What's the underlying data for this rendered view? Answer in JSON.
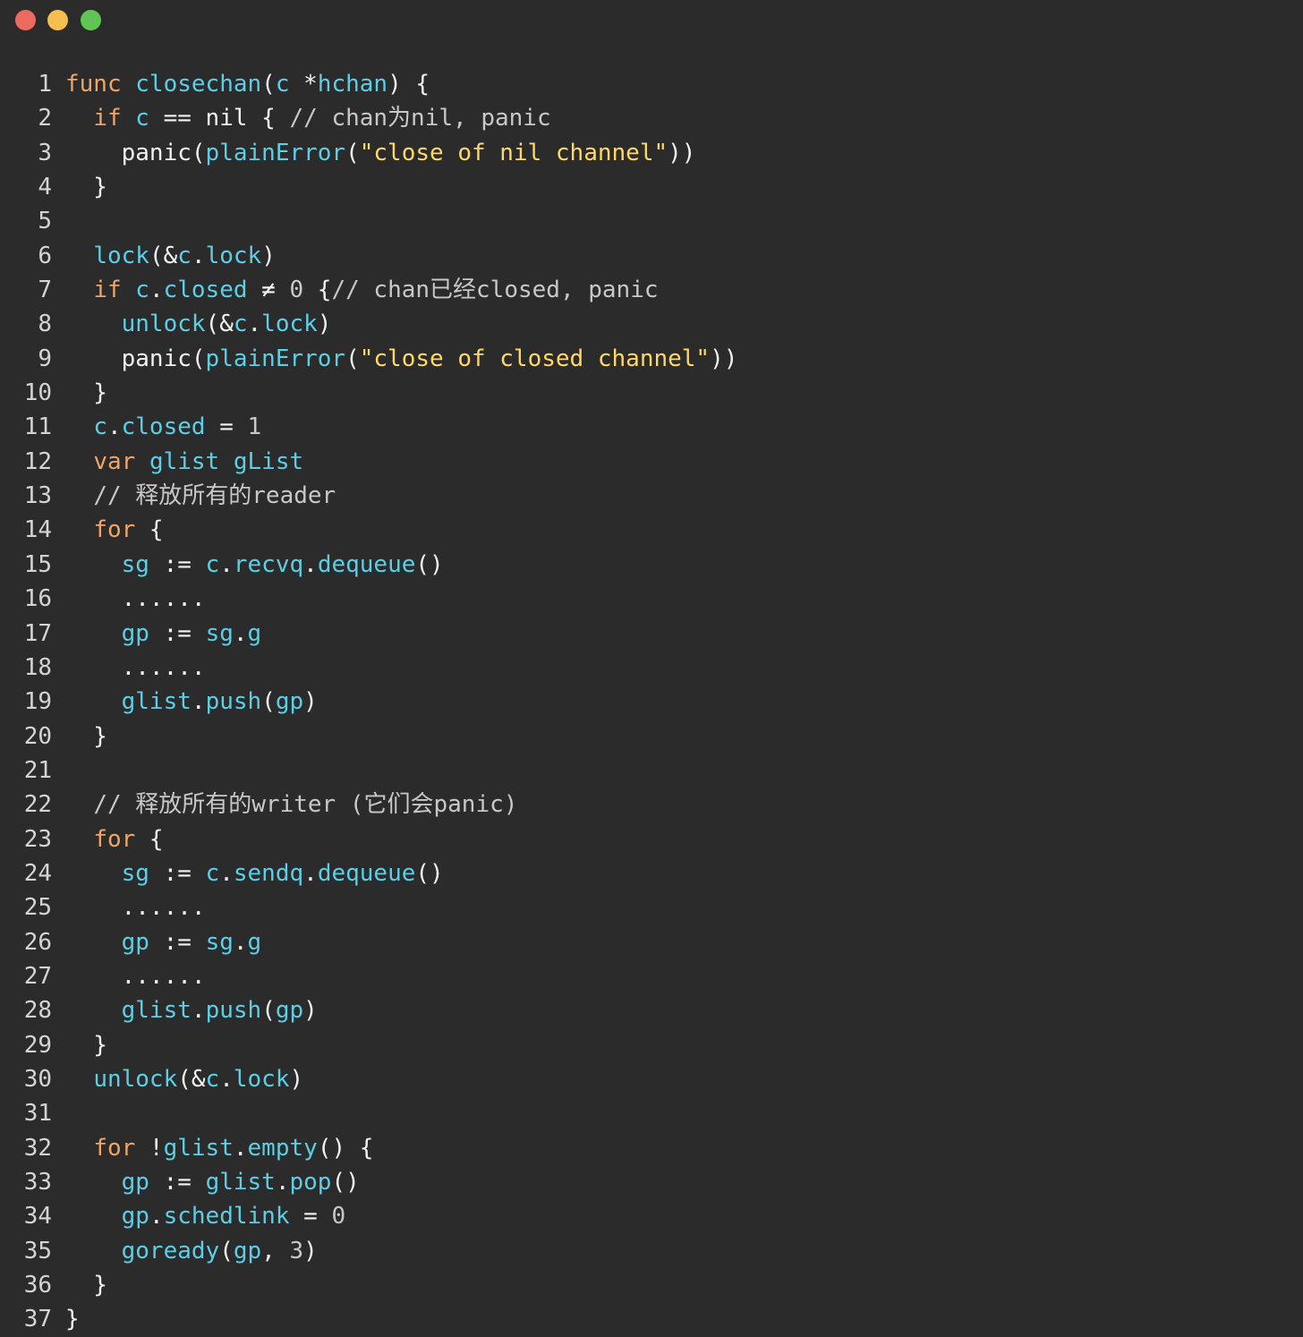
{
  "window": {
    "buttons": {
      "close_color": "#ed6a5e",
      "minimize_color": "#f5bf4f",
      "maximize_color": "#61c554"
    }
  },
  "colors": {
    "background": "#2b2b2b",
    "keyword": "#f0a467",
    "identifier": "#5ccfe6",
    "string": "#ffd866",
    "comment": "#c8c8c8",
    "plain": "#f2f2f2"
  },
  "code": {
    "language": "go",
    "lines": [
      {
        "n": "1",
        "tokens": [
          [
            "kw",
            "func"
          ],
          [
            "p",
            " "
          ],
          [
            "fn",
            "closechan"
          ],
          [
            "p",
            "("
          ],
          [
            "id",
            "c"
          ],
          [
            "p",
            " *"
          ],
          [
            "id",
            "hchan"
          ],
          [
            "p",
            ") {"
          ]
        ]
      },
      {
        "n": "2",
        "tokens": [
          [
            "p",
            "  "
          ],
          [
            "kw",
            "if"
          ],
          [
            "p",
            " "
          ],
          [
            "id",
            "c"
          ],
          [
            "p",
            " == nil { "
          ],
          [
            "com",
            "// chan为nil, panic"
          ]
        ]
      },
      {
        "n": "3",
        "tokens": [
          [
            "p",
            "    panic("
          ],
          [
            "id",
            "plainError"
          ],
          [
            "p",
            "("
          ],
          [
            "str",
            "\"close of nil channel\""
          ],
          [
            "p",
            "))"
          ]
        ]
      },
      {
        "n": "4",
        "tokens": [
          [
            "p",
            "  }"
          ]
        ]
      },
      {
        "n": "5",
        "tokens": []
      },
      {
        "n": "6",
        "tokens": [
          [
            "p",
            "  "
          ],
          [
            "fn",
            "lock"
          ],
          [
            "p",
            "(&"
          ],
          [
            "id",
            "c"
          ],
          [
            "p",
            "."
          ],
          [
            "id",
            "lock"
          ],
          [
            "p",
            ")"
          ]
        ]
      },
      {
        "n": "7",
        "tokens": [
          [
            "p",
            "  "
          ],
          [
            "kw",
            "if"
          ],
          [
            "p",
            " "
          ],
          [
            "id",
            "c"
          ],
          [
            "p",
            "."
          ],
          [
            "id",
            "closed"
          ],
          [
            "p",
            " ≠ "
          ],
          [
            "num",
            "0"
          ],
          [
            "p",
            " {"
          ],
          [
            "com",
            "// chan已经closed, panic"
          ]
        ]
      },
      {
        "n": "8",
        "tokens": [
          [
            "p",
            "    "
          ],
          [
            "fn",
            "unlock"
          ],
          [
            "p",
            "(&"
          ],
          [
            "id",
            "c"
          ],
          [
            "p",
            "."
          ],
          [
            "id",
            "lock"
          ],
          [
            "p",
            ")"
          ]
        ]
      },
      {
        "n": "9",
        "tokens": [
          [
            "p",
            "    panic("
          ],
          [
            "id",
            "plainError"
          ],
          [
            "p",
            "("
          ],
          [
            "str",
            "\"close of closed channel\""
          ],
          [
            "p",
            "))"
          ]
        ]
      },
      {
        "n": "10",
        "tokens": [
          [
            "p",
            "  }"
          ]
        ]
      },
      {
        "n": "11",
        "tokens": [
          [
            "p",
            "  "
          ],
          [
            "id",
            "c"
          ],
          [
            "p",
            "."
          ],
          [
            "id",
            "closed"
          ],
          [
            "p",
            " = "
          ],
          [
            "num",
            "1"
          ]
        ]
      },
      {
        "n": "12",
        "tokens": [
          [
            "p",
            "  "
          ],
          [
            "kw",
            "var"
          ],
          [
            "p",
            " "
          ],
          [
            "id",
            "glist"
          ],
          [
            "p",
            " "
          ],
          [
            "id",
            "gList"
          ]
        ]
      },
      {
        "n": "13",
        "tokens": [
          [
            "p",
            "  "
          ],
          [
            "com",
            "// 释放所有的reader"
          ]
        ]
      },
      {
        "n": "14",
        "tokens": [
          [
            "p",
            "  "
          ],
          [
            "kw",
            "for"
          ],
          [
            "p",
            " {"
          ]
        ]
      },
      {
        "n": "15",
        "tokens": [
          [
            "p",
            "    "
          ],
          [
            "id",
            "sg"
          ],
          [
            "p",
            " := "
          ],
          [
            "id",
            "c"
          ],
          [
            "p",
            "."
          ],
          [
            "id",
            "recvq"
          ],
          [
            "p",
            "."
          ],
          [
            "fn",
            "dequeue"
          ],
          [
            "p",
            "()"
          ]
        ]
      },
      {
        "n": "16",
        "tokens": [
          [
            "p",
            "    ......"
          ]
        ]
      },
      {
        "n": "17",
        "tokens": [
          [
            "p",
            "    "
          ],
          [
            "id",
            "gp"
          ],
          [
            "p",
            " := "
          ],
          [
            "id",
            "sg"
          ],
          [
            "p",
            "."
          ],
          [
            "id",
            "g"
          ]
        ]
      },
      {
        "n": "18",
        "tokens": [
          [
            "p",
            "    ......"
          ]
        ]
      },
      {
        "n": "19",
        "tokens": [
          [
            "p",
            "    "
          ],
          [
            "id",
            "glist"
          ],
          [
            "p",
            "."
          ],
          [
            "fn",
            "push"
          ],
          [
            "p",
            "("
          ],
          [
            "id",
            "gp"
          ],
          [
            "p",
            ")"
          ]
        ]
      },
      {
        "n": "20",
        "tokens": [
          [
            "p",
            "  }"
          ]
        ]
      },
      {
        "n": "21",
        "tokens": []
      },
      {
        "n": "22",
        "tokens": [
          [
            "p",
            "  "
          ],
          [
            "com",
            "// 释放所有的writer (它们会panic)"
          ]
        ]
      },
      {
        "n": "23",
        "tokens": [
          [
            "p",
            "  "
          ],
          [
            "kw",
            "for"
          ],
          [
            "p",
            " {"
          ]
        ]
      },
      {
        "n": "24",
        "tokens": [
          [
            "p",
            "    "
          ],
          [
            "id",
            "sg"
          ],
          [
            "p",
            " := "
          ],
          [
            "id",
            "c"
          ],
          [
            "p",
            "."
          ],
          [
            "id",
            "sendq"
          ],
          [
            "p",
            "."
          ],
          [
            "fn",
            "dequeue"
          ],
          [
            "p",
            "()"
          ]
        ]
      },
      {
        "n": "25",
        "tokens": [
          [
            "p",
            "    ......"
          ]
        ]
      },
      {
        "n": "26",
        "tokens": [
          [
            "p",
            "    "
          ],
          [
            "id",
            "gp"
          ],
          [
            "p",
            " := "
          ],
          [
            "id",
            "sg"
          ],
          [
            "p",
            "."
          ],
          [
            "id",
            "g"
          ]
        ]
      },
      {
        "n": "27",
        "tokens": [
          [
            "p",
            "    ......"
          ]
        ]
      },
      {
        "n": "28",
        "tokens": [
          [
            "p",
            "    "
          ],
          [
            "id",
            "glist"
          ],
          [
            "p",
            "."
          ],
          [
            "fn",
            "push"
          ],
          [
            "p",
            "("
          ],
          [
            "id",
            "gp"
          ],
          [
            "p",
            ")"
          ]
        ]
      },
      {
        "n": "29",
        "tokens": [
          [
            "p",
            "  }"
          ]
        ]
      },
      {
        "n": "30",
        "tokens": [
          [
            "p",
            "  "
          ],
          [
            "fn",
            "unlock"
          ],
          [
            "p",
            "(&"
          ],
          [
            "id",
            "c"
          ],
          [
            "p",
            "."
          ],
          [
            "id",
            "lock"
          ],
          [
            "p",
            ")"
          ]
        ]
      },
      {
        "n": "31",
        "tokens": []
      },
      {
        "n": "32",
        "tokens": [
          [
            "p",
            "  "
          ],
          [
            "kw",
            "for"
          ],
          [
            "p",
            " !"
          ],
          [
            "id",
            "glist"
          ],
          [
            "p",
            "."
          ],
          [
            "fn",
            "empty"
          ],
          [
            "p",
            "() {"
          ]
        ]
      },
      {
        "n": "33",
        "tokens": [
          [
            "p",
            "    "
          ],
          [
            "id",
            "gp"
          ],
          [
            "p",
            " := "
          ],
          [
            "id",
            "glist"
          ],
          [
            "p",
            "."
          ],
          [
            "fn",
            "pop"
          ],
          [
            "p",
            "()"
          ]
        ]
      },
      {
        "n": "34",
        "tokens": [
          [
            "p",
            "    "
          ],
          [
            "id",
            "gp"
          ],
          [
            "p",
            "."
          ],
          [
            "id",
            "schedlink"
          ],
          [
            "p",
            " = "
          ],
          [
            "num",
            "0"
          ]
        ]
      },
      {
        "n": "35",
        "tokens": [
          [
            "p",
            "    "
          ],
          [
            "fn",
            "goready"
          ],
          [
            "p",
            "("
          ],
          [
            "id",
            "gp"
          ],
          [
            "p",
            ", "
          ],
          [
            "num",
            "3"
          ],
          [
            "p",
            ")"
          ]
        ]
      },
      {
        "n": "36",
        "tokens": [
          [
            "p",
            "  }"
          ]
        ]
      },
      {
        "n": "37",
        "tokens": [
          [
            "p",
            "}"
          ]
        ]
      }
    ]
  }
}
